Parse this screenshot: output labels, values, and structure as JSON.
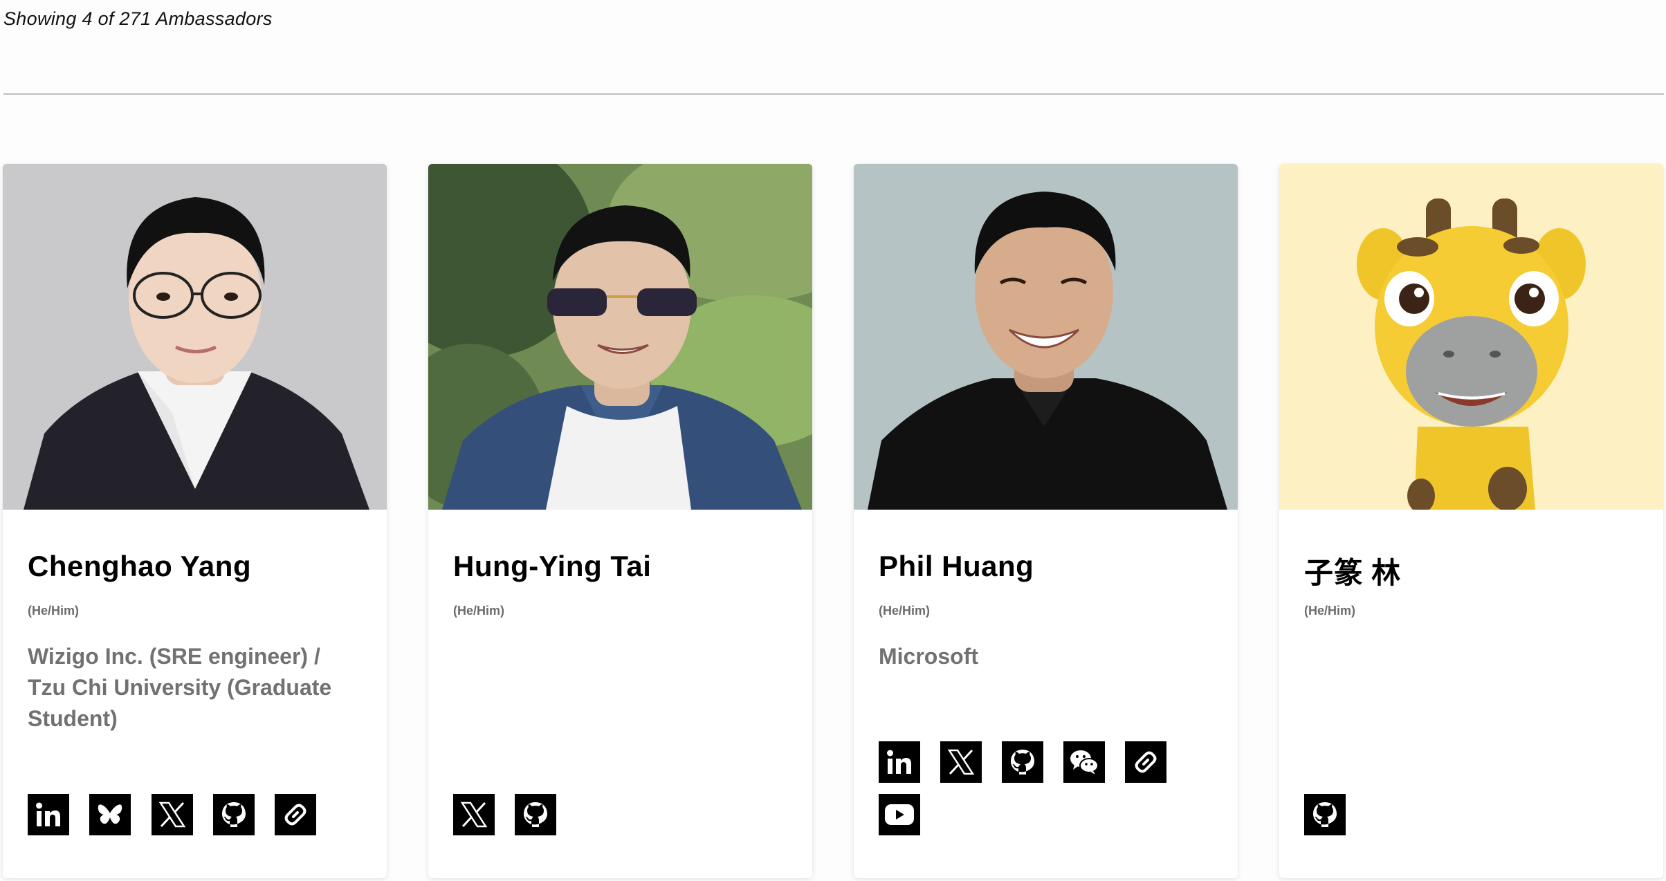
{
  "results": {
    "count_text": "Showing 4 of 271 Ambassadors"
  },
  "ambassadors": [
    {
      "name": "Chenghao Yang",
      "pronouns": "(He/Him)",
      "organization": "Wizigo Inc. (SRE engineer) / Tzu Chi University (Graduate Student)",
      "socials": [
        "linkedin-icon",
        "bluesky-icon",
        "x-icon",
        "github-icon",
        "website-link-icon"
      ]
    },
    {
      "name": "Hung-Ying Tai",
      "pronouns": "(He/Him)",
      "organization": "",
      "socials": [
        "x-icon",
        "github-icon"
      ]
    },
    {
      "name": "Phil Huang",
      "pronouns": "(He/Him)",
      "organization": "Microsoft",
      "socials": [
        "linkedin-icon",
        "x-icon",
        "github-icon",
        "wechat-icon",
        "website-link-icon",
        "youtube-icon"
      ]
    },
    {
      "name": "子篆 林",
      "pronouns": "(He/Him)",
      "organization": "",
      "socials": [
        "github-icon"
      ]
    }
  ],
  "colors": {
    "social_icon_bg": "#000000",
    "social_icon_fg": "#ffffff",
    "org_text": "#717171",
    "pronoun_text": "#6b6b6b",
    "divider": "#bdbdbd"
  }
}
